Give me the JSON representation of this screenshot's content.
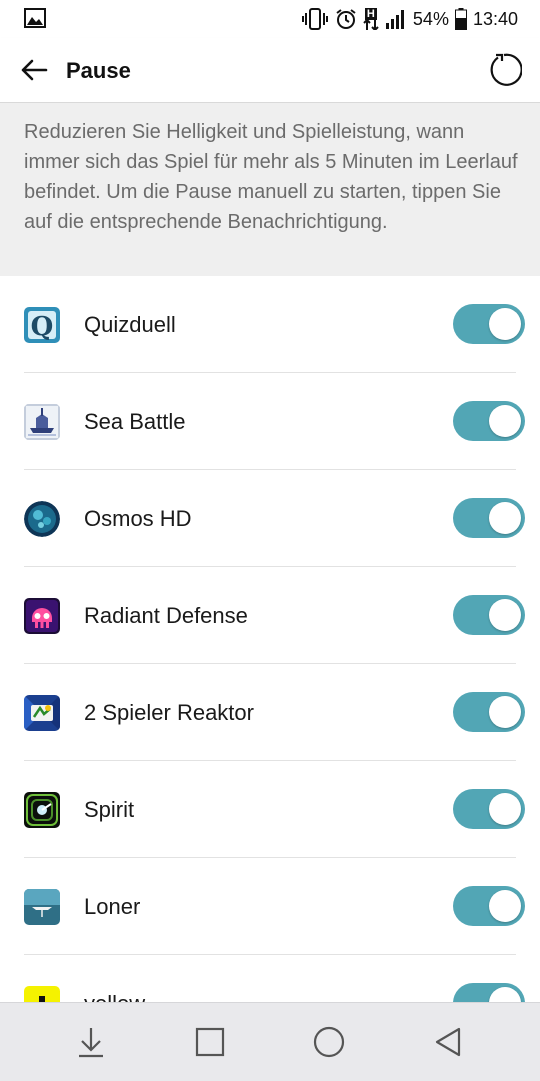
{
  "status_bar": {
    "battery_percent": "54%",
    "time": "13:40",
    "network_label": "H",
    "icons": [
      "image-icon",
      "vibrate-icon",
      "alarm-icon",
      "signal-icon",
      "battery-icon"
    ]
  },
  "app_bar": {
    "title": "Pause",
    "back_icon": "arrow-left-icon",
    "reset_icon": "refresh-icon"
  },
  "description": "Reduzieren Sie Helligkeit und Spielleistung, wann immer sich das Spiel für mehr als 5 Minuten im Leerlauf befindet. Um die Pause manuell zu starten, tippen Sie auf die entsprechende Benachrichtigung.",
  "apps": [
    {
      "name": "Quizduell",
      "enabled": true,
      "icon": "quizduell-icon"
    },
    {
      "name": "Sea Battle",
      "enabled": true,
      "icon": "sea-battle-icon"
    },
    {
      "name": "Osmos HD",
      "enabled": true,
      "icon": "osmos-icon"
    },
    {
      "name": "Radiant Defense",
      "enabled": true,
      "icon": "radiant-defense-icon"
    },
    {
      "name": "2 Spieler Reaktor",
      "enabled": true,
      "icon": "reaktor-icon"
    },
    {
      "name": "Spirit",
      "enabled": true,
      "icon": "spirit-icon"
    },
    {
      "name": "Loner",
      "enabled": true,
      "icon": "loner-icon"
    },
    {
      "name": "yellow",
      "enabled": true,
      "icon": "yellow-icon"
    }
  ],
  "colors": {
    "toggle_on": "#52a6b5",
    "description_bg": "#efefef",
    "description_text": "#6b6b6b",
    "navbar_bg": "#e9e9ec"
  },
  "nav_bar": {
    "icons": [
      "notification-drawer-icon",
      "recents-icon",
      "home-icon",
      "back-icon"
    ]
  }
}
